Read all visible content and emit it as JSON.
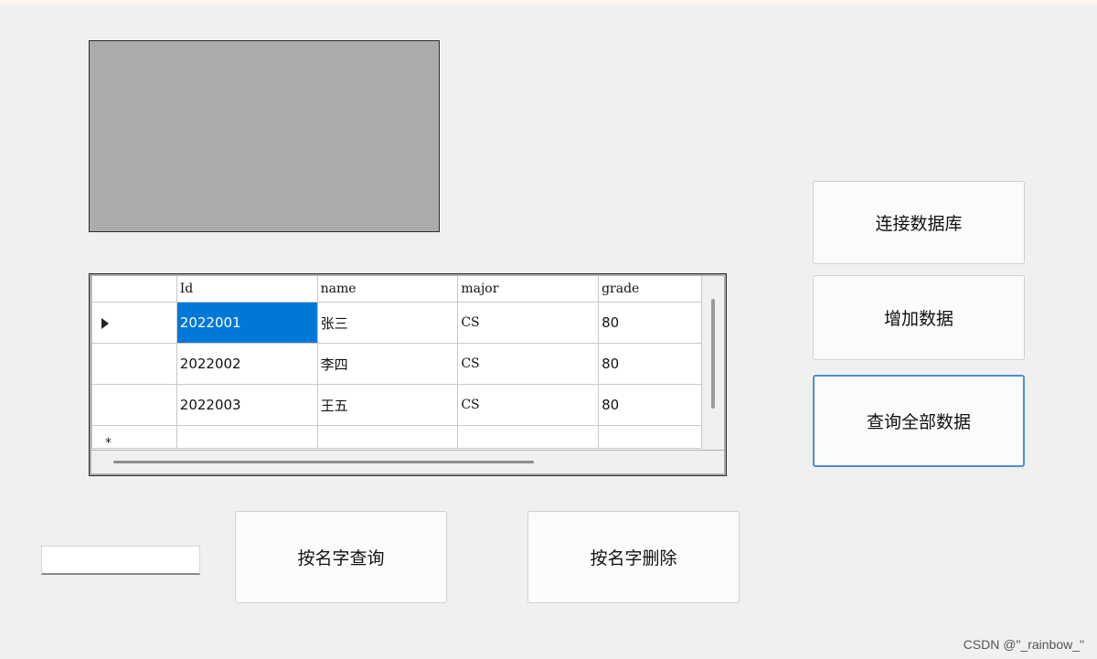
{
  "grid": {
    "columns": [
      "Id",
      "name",
      "major",
      "grade"
    ],
    "rows": [
      {
        "id": "2022001",
        "name": "张三",
        "major": "CS",
        "grade": "80"
      },
      {
        "id": "2022002",
        "name": "李四",
        "major": "CS",
        "grade": "80"
      },
      {
        "id": "2022003",
        "name": "王五",
        "major": "CS",
        "grade": "80"
      }
    ]
  },
  "buttons": {
    "connect_db": "连接数据库",
    "add_data": "增加数据",
    "query_all": "查询全部数据",
    "query_by_name": "按名字查询",
    "delete_by_name": "按名字删除"
  },
  "name_input": {
    "value": ""
  },
  "watermark": "CSDN @\"_rainbow_\"",
  "colors": {
    "selection": "#0078d7",
    "focus_border": "#4a8fd6",
    "picture_box": "#ababab"
  }
}
